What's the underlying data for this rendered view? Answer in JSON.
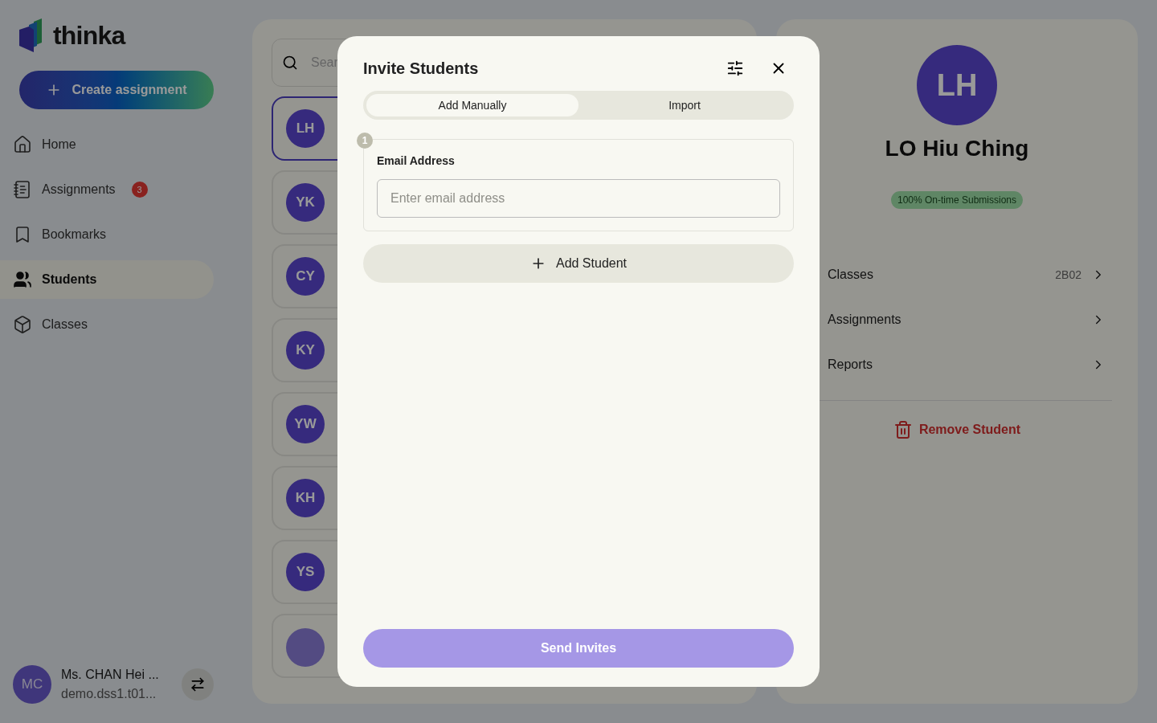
{
  "sidebar": {
    "logo": "thinka",
    "create_button": "Create assignment",
    "items": [
      {
        "kind": "home",
        "label": "Home",
        "selected": false
      },
      {
        "kind": "assignments",
        "label": "Assignments",
        "selected": false,
        "badge": "3"
      },
      {
        "kind": "bookmarks",
        "label": "Bookmarks",
        "selected": false
      },
      {
        "kind": "students",
        "label": "Students",
        "selected": true
      },
      {
        "kind": "classes",
        "label": "Classes",
        "selected": false
      }
    ],
    "user": {
      "initials": "MC",
      "name": "Ms. CHAN Hei ...",
      "email": "demo.dss1.t01..."
    }
  },
  "student_list": {
    "search": {
      "placeholder": "Sear"
    },
    "students": [
      {
        "initials": "LH",
        "selected": true
      },
      {
        "initials": "YK",
        "selected": false
      },
      {
        "initials": "CY",
        "selected": false
      },
      {
        "initials": "KY",
        "selected": false
      },
      {
        "initials": "YW",
        "selected": false
      },
      {
        "initials": "KH",
        "selected": false
      },
      {
        "initials": "YS",
        "selected": false
      }
    ]
  },
  "profile": {
    "initials": "LH",
    "name": "LO Hiu Ching",
    "badge": "100% On-time Submissions",
    "rows": [
      {
        "label": "Classes",
        "value": "2B02"
      },
      {
        "label": "Assignments"
      },
      {
        "label": "Reports"
      }
    ],
    "remove_button": "Remove Student"
  },
  "modal": {
    "title": "Invite Students",
    "tabs": [
      {
        "label": "Add Manually",
        "selected": true
      },
      {
        "label": "Import",
        "selected": false
      }
    ],
    "entries": [
      {
        "number": "1",
        "label": "Email Address",
        "placeholder": "Enter email address"
      }
    ],
    "add_button": "Add Student",
    "send_button": {
      "label": "Send Invites",
      "disabled": true
    }
  }
}
